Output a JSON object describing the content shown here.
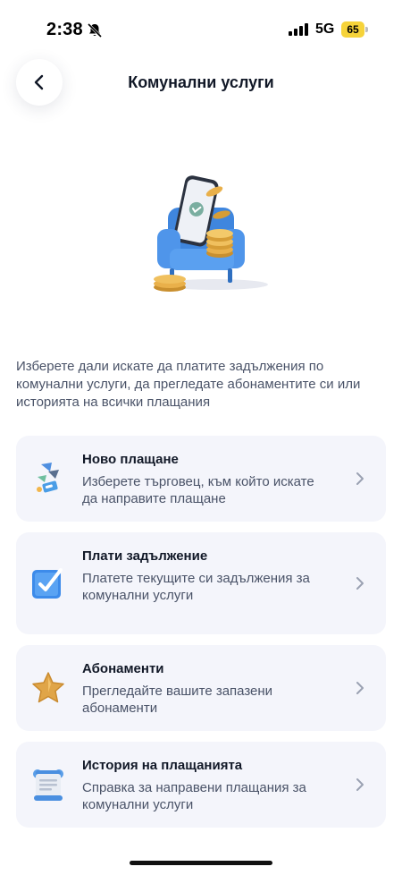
{
  "status_bar": {
    "time": "2:38",
    "network": "5G",
    "battery": "65",
    "icons": [
      "bell-slash-icon",
      "signal-icon",
      "battery-icon"
    ]
  },
  "header": {
    "title": "Комунални услуги",
    "back_icon": "chevron-left-icon"
  },
  "hero": {
    "icon": "armchair-phone-coins-illustration"
  },
  "description": "Изберете дали искате да платите задължения по комунални услуги, да прегледате абонаментите си или историята на всички плащания",
  "options": [
    {
      "title": "Ново плащане",
      "subtitle": "Изберете търговец, към който искате да направите плащане",
      "icon": "payment-tokens-icon"
    },
    {
      "title": "Плати задължение",
      "subtitle": "Платете текущите си задължения за комунални услуги",
      "icon": "checkbox-icon"
    },
    {
      "title": "Абонаменти",
      "subtitle": "Прегледайте вашите запазени абонаменти",
      "icon": "star-icon"
    },
    {
      "title": "История на плащанията",
      "subtitle": "Справка за направени плащания за комунални услуги",
      "icon": "receipt-scroll-icon"
    }
  ],
  "colors": {
    "card_background": "#f4f5fb",
    "accent_blue": "#3d8bea",
    "coin_gold": "#e9b04a",
    "chevron": "#9aa1b2"
  }
}
